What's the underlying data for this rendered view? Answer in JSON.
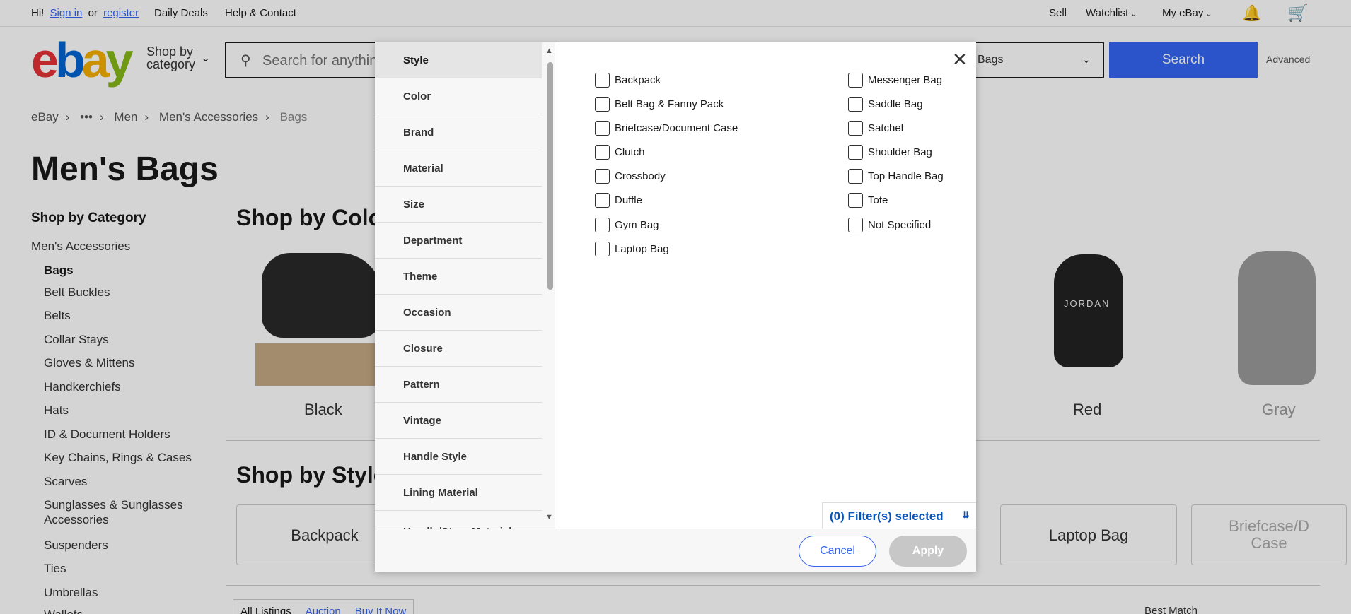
{
  "topbar": {
    "greeting": "Hi!",
    "sign_in": "Sign in",
    "or": "or",
    "register": "register",
    "daily_deals": "Daily Deals",
    "help_contact": "Help & Contact",
    "sell": "Sell",
    "watchlist": "Watchlist",
    "my_ebay": "My eBay"
  },
  "header": {
    "logo_letters": [
      "e",
      "b",
      "a",
      "y"
    ],
    "shop_by": "Shop by",
    "category": "category",
    "search_placeholder": "Search for anythin",
    "search_category": "Bags",
    "search_button": "Search",
    "advanced": "Advanced"
  },
  "breadcrumb": {
    "items": [
      "eBay",
      "•••",
      "Men",
      "Men's Accessories",
      "Bags"
    ]
  },
  "page": {
    "title": "Men's Bags"
  },
  "sidebar": {
    "heading": "Shop by Category",
    "parent": "Men's Accessories",
    "items": [
      "Bags",
      "Belt Buckles",
      "Belts",
      "Collar Stays",
      "Gloves & Mittens",
      "Handkerchiefs",
      "Hats",
      "ID & Document Holders",
      "Key Chains, Rings & Cases",
      "Scarves",
      "Sunglasses & Sunglasses",
      "Accessories",
      "Suspenders",
      "Ties",
      "Umbrellas",
      "Wallets"
    ]
  },
  "main": {
    "shop_by_color": "Shop by Colo",
    "colors": [
      "Black",
      "Red",
      "Gray"
    ],
    "jordan_text": "JORDAN",
    "shop_by_style": "Shop by Style",
    "styles": [
      "Backpack",
      "Laptop Bag",
      "Briefcase/D",
      "Case"
    ],
    "listing_tabs": [
      "All Listings",
      "Auction",
      "Buy It Now"
    ],
    "sort": "Best Match"
  },
  "dialog": {
    "nav_items": [
      "Style",
      "Color",
      "Brand",
      "Material",
      "Size",
      "Department",
      "Theme",
      "Occasion",
      "Closure",
      "Pattern",
      "Vintage",
      "Handle Style",
      "Lining Material",
      "Handle/Strap Material"
    ],
    "active_nav": "Style",
    "options_left": [
      "Backpack",
      "Belt Bag & Fanny Pack",
      "Briefcase/Document Case",
      "Clutch",
      "Crossbody",
      "Duffle",
      "Gym Bag",
      "Laptop Bag"
    ],
    "options_right": [
      "Messenger Bag",
      "Saddle Bag",
      "Satchel",
      "Shoulder Bag",
      "Top Handle Bag",
      "Tote",
      "Not Specified"
    ],
    "filters_selected": "(0) Filter(s) selected",
    "cancel": "Cancel",
    "apply": "Apply"
  }
}
